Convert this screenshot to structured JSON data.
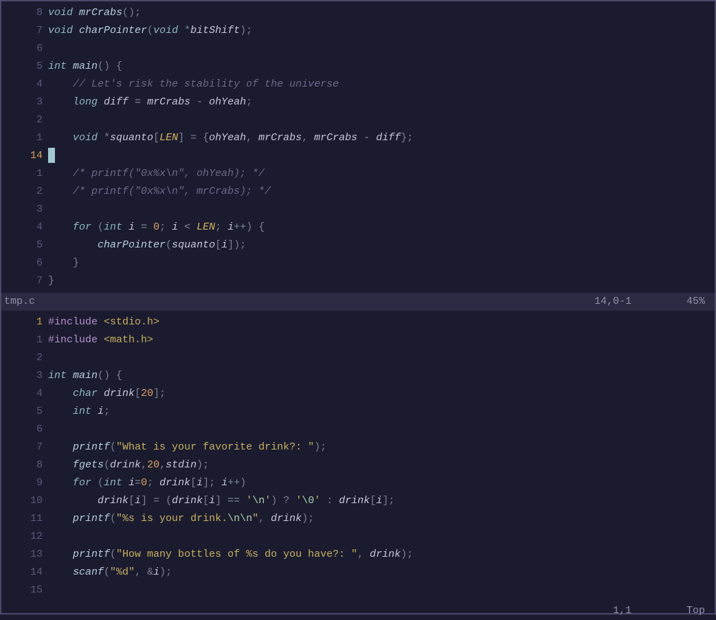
{
  "top_pane": {
    "filename": "tmp.c",
    "cursor_pos": "14,0-1",
    "percent": "45%",
    "lines": [
      {
        "n": "8",
        "t": [
          [
            "c-type",
            "void"
          ],
          [
            "",
            ""
          ],
          [
            "c-func",
            " mrCrabs"
          ],
          [
            "c-punc",
            "();"
          ]
        ]
      },
      {
        "n": "7",
        "t": [
          [
            "c-type",
            "void"
          ],
          [
            "c-func",
            " charPointer"
          ],
          [
            "c-punc",
            "("
          ],
          [
            "c-type",
            "void"
          ],
          [
            "c-punc",
            " *"
          ],
          [
            "c-ident",
            "bitShift"
          ],
          [
            "c-punc",
            ");"
          ]
        ]
      },
      {
        "n": "6",
        "t": [
          [
            "",
            ""
          ]
        ]
      },
      {
        "n": "5",
        "t": [
          [
            "c-type",
            "int"
          ],
          [
            "c-func",
            " main"
          ],
          [
            "c-punc",
            "() {"
          ]
        ]
      },
      {
        "n": "4",
        "t": [
          [
            "",
            "    "
          ],
          [
            "c-cmt",
            "// Let's risk the stability of the universe"
          ]
        ]
      },
      {
        "n": "3",
        "t": [
          [
            "",
            "    "
          ],
          [
            "c-type",
            "long"
          ],
          [
            "",
            ""
          ],
          [
            "c-ident",
            " diff"
          ],
          [
            "c-op",
            " = "
          ],
          [
            "c-ident",
            "mrCrabs"
          ],
          [
            "c-op",
            " - "
          ],
          [
            "c-ident",
            "ohYeah"
          ],
          [
            "c-punc",
            ";"
          ]
        ]
      },
      {
        "n": "2",
        "t": [
          [
            "",
            ""
          ]
        ]
      },
      {
        "n": "1",
        "t": [
          [
            "",
            "    "
          ],
          [
            "c-type",
            "void"
          ],
          [
            "c-punc",
            " *"
          ],
          [
            "c-ident",
            "squanto"
          ],
          [
            "c-punc",
            "["
          ],
          [
            "c-const",
            "LEN"
          ],
          [
            "c-punc",
            "] = {"
          ],
          [
            "c-ident",
            "ohYeah"
          ],
          [
            "c-punc",
            ", "
          ],
          [
            "c-ident",
            "mrCrabs"
          ],
          [
            "c-punc",
            ", "
          ],
          [
            "c-ident",
            "mrCrabs"
          ],
          [
            "c-op",
            " - "
          ],
          [
            "c-ident",
            "diff"
          ],
          [
            "c-punc",
            "};"
          ]
        ]
      },
      {
        "n": "14",
        "current": true,
        "cursor": true,
        "t": [
          [
            "",
            ""
          ]
        ]
      },
      {
        "n": "1",
        "t": [
          [
            "",
            "    "
          ],
          [
            "c-cmt",
            "/* printf(\"0x%x\\n\", ohYeah); */"
          ]
        ]
      },
      {
        "n": "2",
        "t": [
          [
            "",
            "    "
          ],
          [
            "c-cmt",
            "/* printf(\"0x%x\\n\", mrCrabs); */"
          ]
        ]
      },
      {
        "n": "3",
        "t": [
          [
            "",
            ""
          ]
        ]
      },
      {
        "n": "4",
        "t": [
          [
            "",
            "    "
          ],
          [
            "c-kw",
            "for"
          ],
          [
            "c-punc",
            " ("
          ],
          [
            "c-type",
            "int"
          ],
          [
            "c-ident",
            " i"
          ],
          [
            "c-op",
            " = "
          ],
          [
            "c-num",
            "0"
          ],
          [
            "c-punc",
            "; "
          ],
          [
            "c-ident",
            "i"
          ],
          [
            "c-op",
            " < "
          ],
          [
            "c-const",
            "LEN"
          ],
          [
            "c-punc",
            "; "
          ],
          [
            "c-ident",
            "i"
          ],
          [
            "c-op",
            "++"
          ],
          [
            "c-punc",
            ") {"
          ]
        ]
      },
      {
        "n": "5",
        "t": [
          [
            "",
            "        "
          ],
          [
            "c-func",
            "charPointer"
          ],
          [
            "c-punc",
            "("
          ],
          [
            "c-ident",
            "squanto"
          ],
          [
            "c-punc",
            "["
          ],
          [
            "c-ident",
            "i"
          ],
          [
            "c-punc",
            "]);"
          ]
        ]
      },
      {
        "n": "6",
        "t": [
          [
            "",
            "    "
          ],
          [
            "c-punc",
            "}"
          ]
        ]
      },
      {
        "n": "7",
        "t": [
          [
            "c-punc",
            "}"
          ]
        ]
      }
    ]
  },
  "bottom_pane": {
    "cursor_pos": "1,1",
    "percent": "Top",
    "lines": [
      {
        "n": "1",
        "current": true,
        "t": [
          [
            "c-pp",
            "#include"
          ],
          [
            "",
            ""
          ],
          [
            "c-ppinc",
            " <stdio.h>"
          ]
        ]
      },
      {
        "n": "1",
        "t": [
          [
            "c-pp",
            "#include"
          ],
          [
            "c-ppinc",
            " <math.h>"
          ]
        ]
      },
      {
        "n": "2",
        "t": [
          [
            "",
            ""
          ]
        ]
      },
      {
        "n": "3",
        "t": [
          [
            "c-type",
            "int"
          ],
          [
            "c-func",
            " main"
          ],
          [
            "c-punc",
            "() {"
          ]
        ]
      },
      {
        "n": "4",
        "t": [
          [
            "",
            "    "
          ],
          [
            "c-type",
            "char"
          ],
          [
            "c-ident",
            " drink"
          ],
          [
            "c-punc",
            "["
          ],
          [
            "c-num",
            "20"
          ],
          [
            "c-punc",
            "];"
          ]
        ]
      },
      {
        "n": "5",
        "t": [
          [
            "",
            "    "
          ],
          [
            "c-type",
            "int"
          ],
          [
            "c-ident",
            " i"
          ],
          [
            "c-punc",
            ";"
          ]
        ]
      },
      {
        "n": "6",
        "t": [
          [
            "",
            ""
          ]
        ]
      },
      {
        "n": "7",
        "t": [
          [
            "",
            "    "
          ],
          [
            "c-func",
            "printf"
          ],
          [
            "c-punc",
            "("
          ],
          [
            "c-str",
            "\"What is your favorite drink?: \""
          ],
          [
            "c-punc",
            ");"
          ]
        ]
      },
      {
        "n": "8",
        "t": [
          [
            "",
            "    "
          ],
          [
            "c-func",
            "fgets"
          ],
          [
            "c-punc",
            "("
          ],
          [
            "c-ident",
            "drink"
          ],
          [
            "c-punc",
            ","
          ],
          [
            "c-num",
            "20"
          ],
          [
            "c-punc",
            ","
          ],
          [
            "c-ident",
            "stdin"
          ],
          [
            "c-punc",
            ");"
          ]
        ]
      },
      {
        "n": "9",
        "t": [
          [
            "",
            "    "
          ],
          [
            "c-kw",
            "for"
          ],
          [
            "c-punc",
            " ("
          ],
          [
            "c-type",
            "int"
          ],
          [
            "c-ident",
            " i"
          ],
          [
            "c-op",
            "="
          ],
          [
            "c-num",
            "0"
          ],
          [
            "c-punc",
            "; "
          ],
          [
            "c-ident",
            "drink"
          ],
          [
            "c-punc",
            "["
          ],
          [
            "c-ident",
            "i"
          ],
          [
            "c-punc",
            "]; "
          ],
          [
            "c-ident",
            "i"
          ],
          [
            "c-op",
            "++"
          ],
          [
            "c-punc",
            ")"
          ]
        ]
      },
      {
        "n": "10",
        "t": [
          [
            "",
            "        "
          ],
          [
            "c-ident",
            "drink"
          ],
          [
            "c-punc",
            "["
          ],
          [
            "c-ident",
            "i"
          ],
          [
            "c-punc",
            "] = ("
          ],
          [
            "c-ident",
            "drink"
          ],
          [
            "c-punc",
            "["
          ],
          [
            "c-ident",
            "i"
          ],
          [
            "c-punc",
            "] "
          ],
          [
            "c-op",
            "=="
          ],
          [
            "c-punc",
            " "
          ],
          [
            "c-str",
            "'"
          ],
          [
            "c-esc",
            "\\n"
          ],
          [
            "c-str",
            "'"
          ],
          [
            "c-punc",
            ") ? "
          ],
          [
            "c-str",
            "'"
          ],
          [
            "c-esc",
            "\\0"
          ],
          [
            "c-str",
            "'"
          ],
          [
            "c-punc",
            " : "
          ],
          [
            "c-ident",
            "drink"
          ],
          [
            "c-punc",
            "["
          ],
          [
            "c-ident",
            "i"
          ],
          [
            "c-punc",
            "];"
          ]
        ]
      },
      {
        "n": "11",
        "t": [
          [
            "",
            "    "
          ],
          [
            "c-func",
            "printf"
          ],
          [
            "c-punc",
            "("
          ],
          [
            "c-str",
            "\"%s is your drink."
          ],
          [
            "c-esc",
            "\\n\\n"
          ],
          [
            "c-str",
            "\""
          ],
          [
            "c-punc",
            ", "
          ],
          [
            "c-ident",
            "drink"
          ],
          [
            "c-punc",
            ");"
          ]
        ]
      },
      {
        "n": "12",
        "t": [
          [
            "",
            ""
          ]
        ]
      },
      {
        "n": "13",
        "t": [
          [
            "",
            "    "
          ],
          [
            "c-func",
            "printf"
          ],
          [
            "c-punc",
            "("
          ],
          [
            "c-str",
            "\"How many bottles of %s do you have?: \""
          ],
          [
            "c-punc",
            ", "
          ],
          [
            "c-ident",
            "drink"
          ],
          [
            "c-punc",
            ");"
          ]
        ]
      },
      {
        "n": "14",
        "t": [
          [
            "",
            "    "
          ],
          [
            "c-func",
            "scanf"
          ],
          [
            "c-punc",
            "("
          ],
          [
            "c-str",
            "\"%d\""
          ],
          [
            "c-punc",
            ", &"
          ],
          [
            "c-ident",
            "i"
          ],
          [
            "c-punc",
            ");"
          ]
        ]
      },
      {
        "n": "15",
        "t": [
          [
            "",
            ""
          ]
        ]
      }
    ]
  }
}
